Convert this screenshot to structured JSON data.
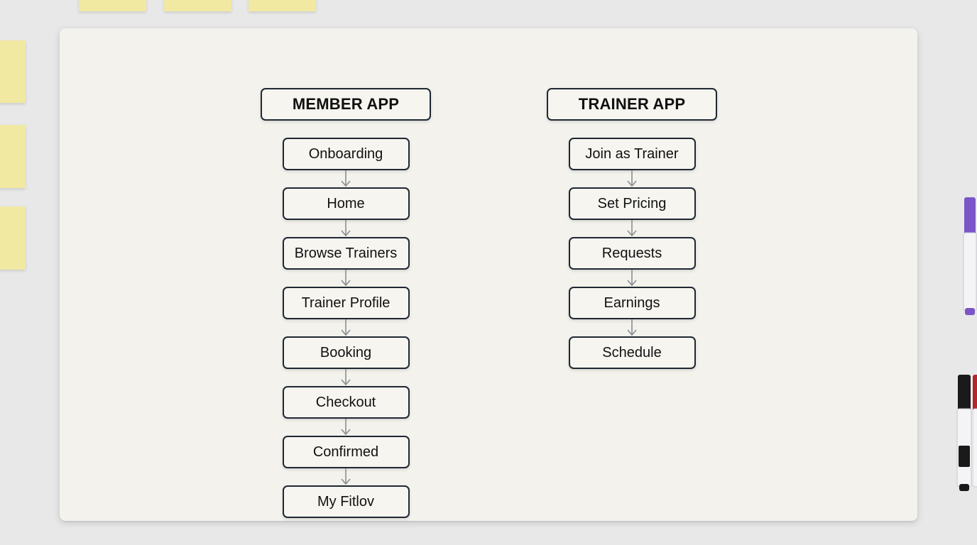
{
  "member_app": {
    "title": "MEMBER APP",
    "steps": [
      {
        "label": "Onboarding"
      },
      {
        "label": "Home"
      },
      {
        "label": "Browse Trainers"
      },
      {
        "label": "Trainer Profile"
      },
      {
        "label": "Booking"
      },
      {
        "label": "Checkout"
      },
      {
        "label": "Confirmed"
      },
      {
        "label": "My Fitlov"
      }
    ]
  },
  "trainer_app": {
    "title": "TRAINER APP",
    "steps": [
      {
        "label": "Join as Trainer"
      },
      {
        "label": "Set Pricing"
      },
      {
        "label": "Requests"
      },
      {
        "label": "Earnings"
      },
      {
        "label": "Schedule"
      }
    ]
  },
  "colors": {
    "sticky_note": "#f1e9a1",
    "board": "#f3f2ec",
    "box_border": "#1f2833",
    "arrow": "#8a8f94",
    "marker_purple": "#7b55c7",
    "marker_black": "#1a1a1a",
    "marker_red": "#b3262a"
  }
}
